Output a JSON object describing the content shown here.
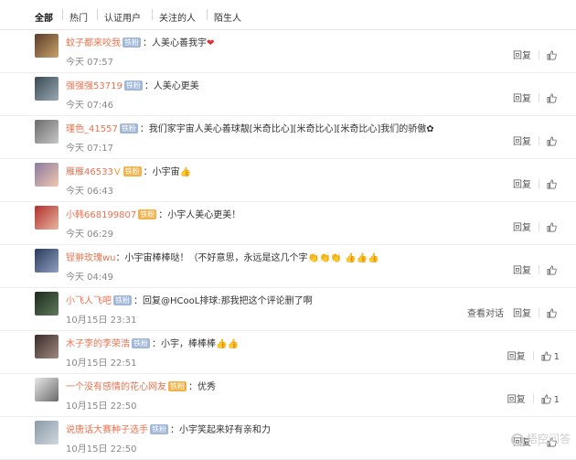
{
  "tabs": [
    "全部",
    "热门",
    "认证用户",
    "关注的人",
    "陌生人"
  ],
  "comments": [
    {
      "user": "蚊子都来咬我",
      "badge": "铁粉",
      "badge_style": "blue",
      "vip": "",
      "text": "：人美心善我宇",
      "deco": "❤",
      "time": "今天 07:57",
      "actions": [
        "回复"
      ],
      "likes": "",
      "avatar_colors": [
        "#5b3b2a",
        "#c9a36a"
      ]
    },
    {
      "user": "强强强53719",
      "badge": "铁粉",
      "badge_style": "blue",
      "vip": "",
      "text": "：人美心更美",
      "deco": "",
      "time": "今天 07:46",
      "actions": [
        "回复"
      ],
      "likes": "",
      "avatar_colors": [
        "#3a4a55",
        "#9aa9b2"
      ]
    },
    {
      "user": "瑾色_41557",
      "badge": "铁粉",
      "badge_style": "blue",
      "vip": "",
      "text": "：我们家宇宙人美心善球靓[米奇比心][米奇比心][米奇比心]我们的骄傲",
      "deco": "✿",
      "time": "今天 07:17",
      "actions": [
        "回复"
      ],
      "likes": "",
      "avatar_colors": [
        "#6b6b6b",
        "#c7c7c7"
      ]
    },
    {
      "user": "雁雁46533",
      "badge": "铁粉",
      "badge_style": "gold",
      "vip": "V",
      "text": "：小宇宙",
      "deco": "👍",
      "time": "今天 06:43",
      "actions": [
        "回复"
      ],
      "likes": "",
      "avatar_colors": [
        "#8a7aa0",
        "#f0c8b0"
      ]
    },
    {
      "user": "小韩668199807",
      "badge": "铁粉",
      "badge_style": "gold",
      "vip": "",
      "text": "：小宇人美心更美！",
      "deco": "",
      "time": "今天 06:29",
      "actions": [
        "回复"
      ],
      "likes": "",
      "avatar_colors": [
        "#b0302c",
        "#e9b4a0"
      ]
    },
    {
      "user": "锃翀玫瑰wu",
      "badge": "",
      "badge_style": "blue",
      "vip": "",
      "text": "：小宇宙棒棒哒！（不好意思，永远是这几个字",
      "deco": "👏👏👏 👍👍👍",
      "time": "今天 04:49",
      "actions": [
        "回复"
      ],
      "likes": "",
      "avatar_colors": [
        "#2a3a5a",
        "#8fa0c0"
      ]
    },
    {
      "user": "小飞人飞吧",
      "badge": "铁粉",
      "badge_style": "blue",
      "vip": "",
      "text": "：回复@HCooL排球:",
      "deco": "那我把这个评论删了啊",
      "time": "10月15日 23:31",
      "actions": [
        "查看对话",
        "回复"
      ],
      "likes": "",
      "avatar_colors": [
        "#1e2a1e",
        "#5f7a5a"
      ]
    },
    {
      "user": "木子李的李荣浩",
      "badge": "铁粉",
      "badge_style": "blue",
      "vip": "",
      "text": "：小宇，棒棒棒",
      "deco": "👍👍",
      "time": "10月15日 22:51",
      "actions": [
        "回复"
      ],
      "likes": "1",
      "avatar_colors": [
        "#3a2a2a",
        "#a08a80"
      ]
    },
    {
      "user": "一个没有感情的花心网友",
      "badge": "铁粉",
      "badge_style": "gold",
      "vip": "",
      "text": "：优秀",
      "deco": "",
      "time": "10月15日 22:50",
      "actions": [
        "回复"
      ],
      "likes": "1",
      "avatar_colors": [
        "#e8e8e8",
        "#6a6a6a"
      ]
    },
    {
      "user": "说唐话大赛种子选手",
      "badge": "铁粉",
      "badge_style": "blue",
      "vip": "",
      "text": "：小宇笑起来好有亲和力",
      "deco": "",
      "time": "10月15日 22:50",
      "actions": [
        "回复"
      ],
      "likes": "",
      "avatar_colors": [
        "#8a9aa8",
        "#d0d8de"
      ]
    }
  ],
  "watermark": "悟空问答"
}
